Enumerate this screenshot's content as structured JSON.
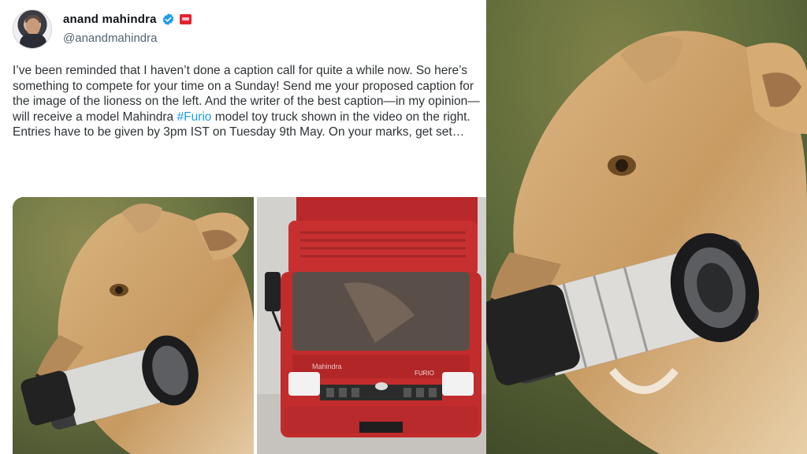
{
  "tweet": {
    "author": {
      "display_name": "anand mahindra",
      "handle": "@anandmahindra",
      "verified_color": "#1d9bf0",
      "badge_color": "#e1232f"
    },
    "text_before_hashtag": "I’ve been reminded that I haven’t done a caption call for quite a while now. So here’s something to compete for your time on a Sunday! Send me your proposed caption for the image of the lioness on the left. And the writer of the best caption—in my opinion—will receive a model Mahindra ",
    "hashtag": "#Furio",
    "text_after_hashtag": " model toy truck shown in the video on the right. Entries have to be given by 3pm IST on Tuesday 9th May. On your marks, get set…",
    "hashtag_color": "#1d9bf0"
  },
  "media": {
    "truck_brand_text": "Mahindra",
    "truck_model_text": "FURIO"
  }
}
